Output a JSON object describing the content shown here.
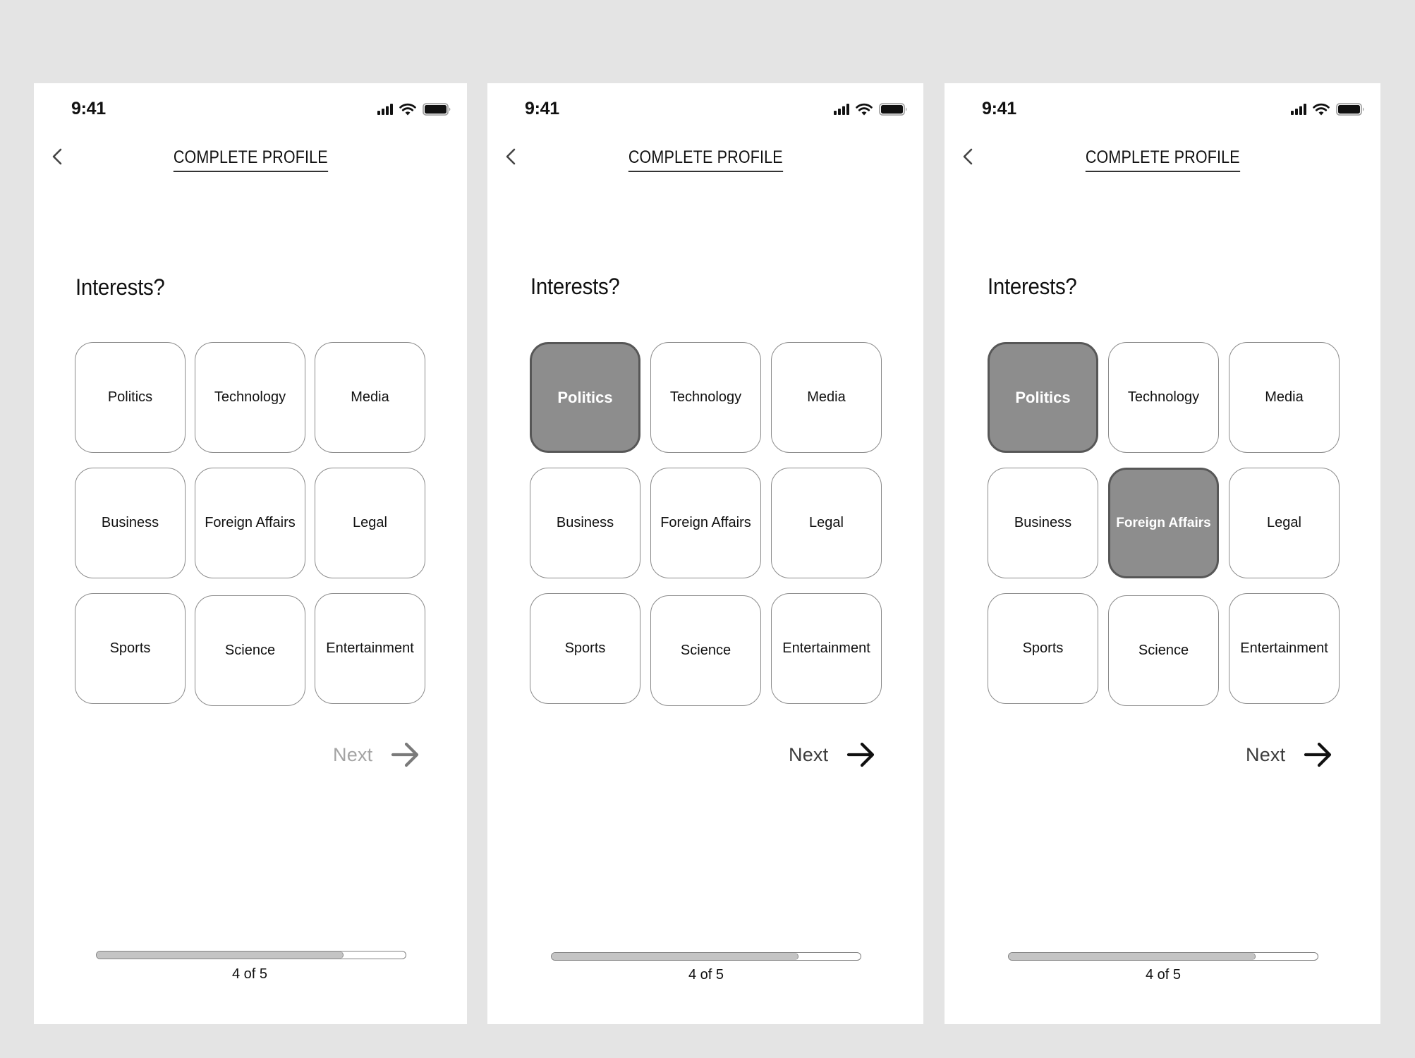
{
  "screens": [
    {
      "status_bar": {
        "time": "9:41",
        "icons": [
          "signal-icon",
          "wifi-icon",
          "battery-icon"
        ]
      },
      "header": {
        "back_icon": "chevron-left-icon",
        "title": "COMPLETE PROFILE"
      },
      "question": "Interests?",
      "options": [
        {
          "label": "Politics",
          "selected": false
        },
        {
          "label": "Technology",
          "selected": false
        },
        {
          "label": "Media",
          "selected": false
        },
        {
          "label": "Business",
          "selected": false
        },
        {
          "label": "Foreign Affairs",
          "selected": false
        },
        {
          "label": "Legal",
          "selected": false
        },
        {
          "label": "Sports",
          "selected": false
        },
        {
          "label": "Science",
          "selected": false
        },
        {
          "label": "Entertainment",
          "selected": false
        }
      ],
      "next": {
        "label": "Next",
        "enabled": false,
        "icon": "arrow-right-icon"
      },
      "progress": {
        "current": 4,
        "total": 5,
        "fraction": 0.8,
        "label": "4 of 5"
      }
    },
    {
      "status_bar": {
        "time": "9:41",
        "icons": [
          "signal-icon",
          "wifi-icon",
          "battery-icon"
        ]
      },
      "header": {
        "back_icon": "chevron-left-icon",
        "title": "COMPLETE PROFILE"
      },
      "question": "Interests?",
      "options": [
        {
          "label": "Politics",
          "selected": true
        },
        {
          "label": "Technology",
          "selected": false
        },
        {
          "label": "Media",
          "selected": false
        },
        {
          "label": "Business",
          "selected": false
        },
        {
          "label": "Foreign Affairs",
          "selected": false
        },
        {
          "label": "Legal",
          "selected": false
        },
        {
          "label": "Sports",
          "selected": false
        },
        {
          "label": "Science",
          "selected": false
        },
        {
          "label": "Entertainment",
          "selected": false
        }
      ],
      "next": {
        "label": "Next",
        "enabled": true,
        "icon": "arrow-right-icon"
      },
      "progress": {
        "current": 4,
        "total": 5,
        "fraction": 0.8,
        "label": "4 of 5"
      }
    },
    {
      "status_bar": {
        "time": "9:41",
        "icons": [
          "signal-icon",
          "wifi-icon",
          "battery-icon"
        ]
      },
      "header": {
        "back_icon": "chevron-left-icon",
        "title": "COMPLETE PROFILE"
      },
      "question": "Interests?",
      "options": [
        {
          "label": "Politics",
          "selected": true
        },
        {
          "label": "Technology",
          "selected": false
        },
        {
          "label": "Media",
          "selected": false
        },
        {
          "label": "Business",
          "selected": false
        },
        {
          "label": "Foreign Affairs",
          "selected": true
        },
        {
          "label": "Legal",
          "selected": false
        },
        {
          "label": "Sports",
          "selected": false
        },
        {
          "label": "Science",
          "selected": false
        },
        {
          "label": "Entertainment",
          "selected": false
        }
      ],
      "next": {
        "label": "Next",
        "enabled": true,
        "icon": "arrow-right-icon"
      },
      "progress": {
        "current": 4,
        "total": 5,
        "fraction": 0.8,
        "label": "4 of 5"
      }
    }
  ],
  "colors": {
    "background": "#e4e4e4",
    "screen": "#ffffff",
    "tile_border": "#8a8a8a",
    "tile_selected_fill": "#8d8d8d",
    "tile_selected_border": "#575757",
    "next_disabled": "#a4a4a4",
    "next_enabled": "#111111",
    "progress_fill": "#c4c4c4"
  }
}
